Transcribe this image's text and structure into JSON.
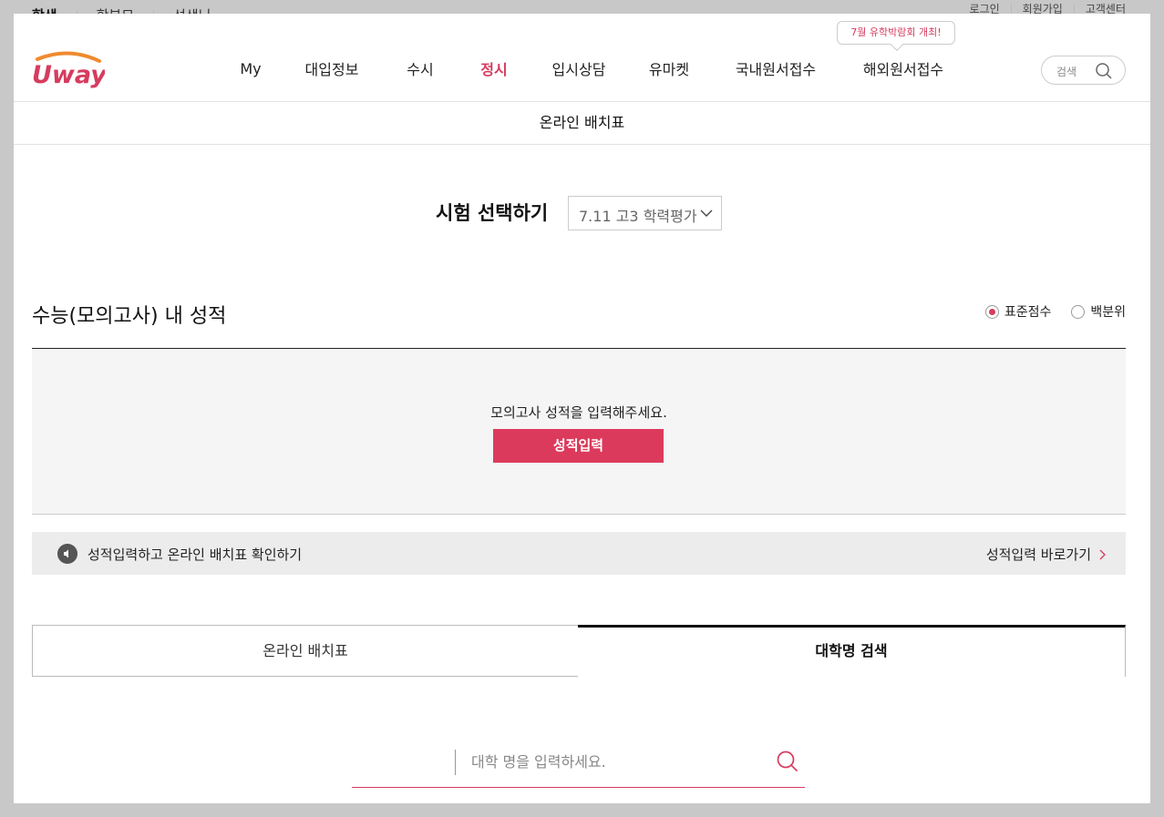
{
  "audience": {
    "items": [
      "학생",
      "학부모",
      "선생님"
    ]
  },
  "util": {
    "login": "로그인",
    "join": "회원가입",
    "support": "고객센터"
  },
  "brand": {
    "logo_text": "Uway"
  },
  "gnb": {
    "items": [
      "My",
      "대입정보",
      "수시",
      "정시",
      "입시상담",
      "유마켓",
      "국내원서접수",
      "해외원서접수"
    ],
    "active": "정시",
    "bubble": "7월 유학박람회 개최!"
  },
  "header_search": {
    "placeholder": "검색"
  },
  "subtitle": "온라인 배치표",
  "exam": {
    "label": "시험 선택하기",
    "selected": "7.11 고3 학력평가"
  },
  "score": {
    "title": "수능(모의고사) 내 성적",
    "radio_standard": "표준점수",
    "radio_percentile": "백분위",
    "selected": "표준점수",
    "message": "모의고사 성적을 입력해주세요.",
    "button": "성적입력"
  },
  "notice": {
    "text": "성적입력하고 온라인 배치표 확인하기",
    "link": "성적입력 바로가기"
  },
  "tabs": {
    "tab1": "온라인 배치표",
    "tab2": "대학명 검색",
    "active": "대학명 검색"
  },
  "univ_search": {
    "placeholder": "대학 명을 입력하세요."
  },
  "colors": {
    "accent": "#dc3a5c",
    "active_nav": "#d63c5e"
  }
}
